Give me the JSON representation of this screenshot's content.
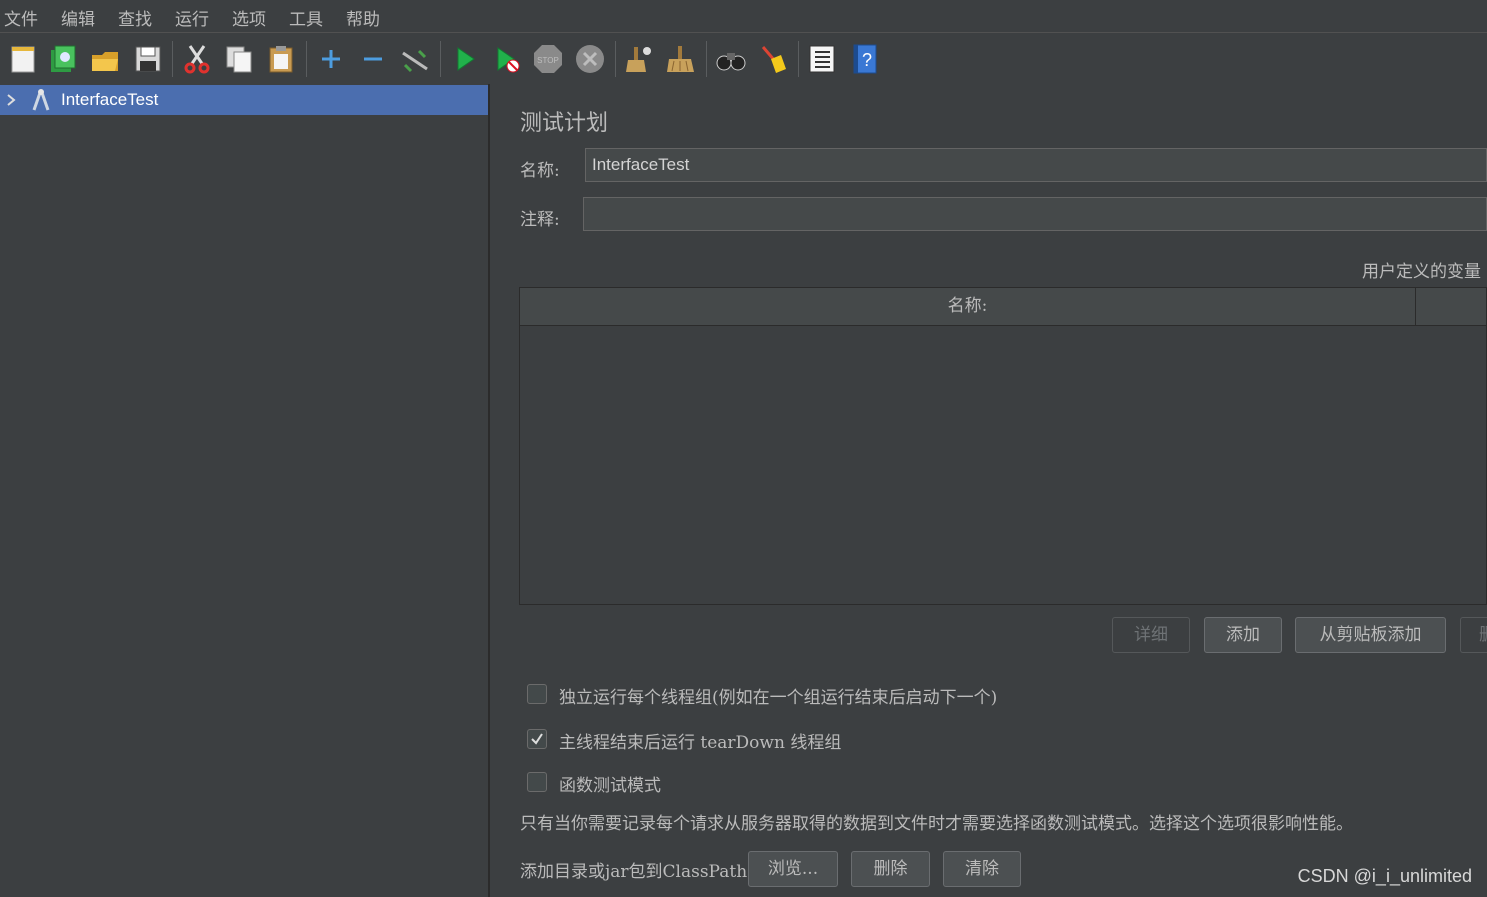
{
  "menu": [
    "文件",
    "编辑",
    "查找",
    "运行",
    "选项",
    "工具",
    "帮助"
  ],
  "toolbar_icons": [
    "new-icon",
    "templates-icon",
    "open-icon",
    "save-icon",
    "cut-icon",
    "copy-icon",
    "paste-icon",
    "expand-icon",
    "collapse-icon",
    "toggle-icon",
    "start-icon",
    "start-no-pauses-icon",
    "stop-icon",
    "shutdown-icon",
    "clear-icon",
    "clear-all-icon",
    "search-icon",
    "reset-search-icon",
    "function-helper-icon",
    "help-icon"
  ],
  "tree": {
    "root_label": "InterfaceTest"
  },
  "panel": {
    "title": "测试计划",
    "name_label": "名称:",
    "name_value": "InterfaceTest",
    "comment_label": "注释:",
    "comment_value": "",
    "vars_title": "用户定义的变量",
    "table_header_name": "名称:",
    "buttons": {
      "detail": "详细",
      "add": "添加",
      "add_clipboard": "从剪贴板添加",
      "delete_partial": "删"
    },
    "checkboxes": [
      {
        "label": "独立运行每个线程组(例如在一个组运行结束后启动下一个)",
        "checked": false
      },
      {
        "label": "主线程结束后运行 tearDown 线程组",
        "checked": true
      },
      {
        "label": "函数测试模式",
        "checked": false
      }
    ],
    "note": "只有当你需要记录每个请求从服务器取得的数据到文件时才需要选择函数测试模式。选择这个选项很影响性能。",
    "classpath_label": "添加目录或jar包到ClassPath",
    "classpath_buttons": {
      "browse": "浏览...",
      "delete": "删除",
      "clear": "清除"
    }
  },
  "watermark": "CSDN @i_i_unlimited",
  "colors": {
    "background": "#3c3f41",
    "selection": "#4b6eaf",
    "input": "#45494a",
    "text": "#bbbbbb"
  }
}
